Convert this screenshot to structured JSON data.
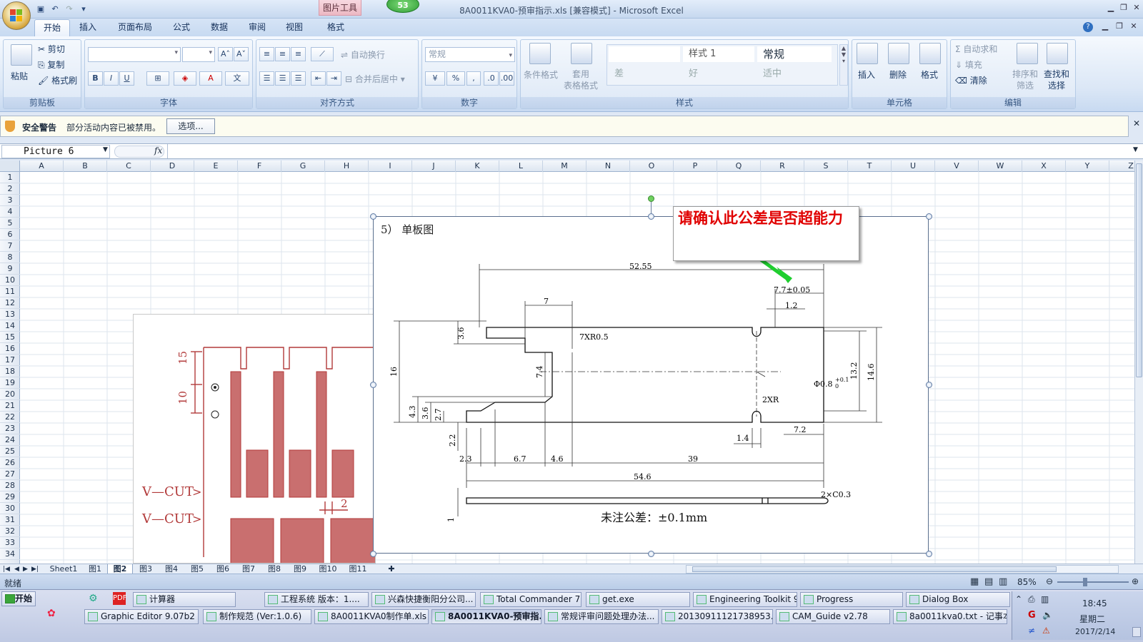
{
  "window": {
    "title": "8A0011KVA0-预审指示.xls  [兼容模式] - Microsoft Excel",
    "contextual_tab": "图片工具",
    "badge": "53"
  },
  "tabs": [
    "开始",
    "插入",
    "页面布局",
    "公式",
    "数据",
    "审阅",
    "视图",
    "格式"
  ],
  "ribbon": {
    "clipboard": {
      "label": "剪贴板",
      "paste": "粘贴",
      "cut": "剪切",
      "copy": "复制",
      "format_painter": "格式刷"
    },
    "font": {
      "label": "字体",
      "bold": "B",
      "italic": "I",
      "underline": "U",
      "grow": "A˄",
      "shrink": "A˅"
    },
    "alignment": {
      "label": "对齐方式",
      "wrap": "自动换行",
      "merge": "合并后居中"
    },
    "number": {
      "label": "数字",
      "format": "常规",
      "percent": "%",
      "comma": ","
    },
    "styles": {
      "label": "样式",
      "conditional": "条件格式",
      "table_format": "套用\n表格格式",
      "cells": [
        "样式 1",
        "常规",
        "差",
        "好",
        "适中"
      ]
    },
    "cells": {
      "label": "单元格",
      "insert": "插入",
      "delete": "删除",
      "format": "格式"
    },
    "editing": {
      "label": "编辑",
      "autosum": "自动求和",
      "fill": "填充",
      "clear": "清除",
      "sort": "排序和\n筛选",
      "find": "查找和\n选择"
    }
  },
  "security": {
    "title": "安全警告",
    "message": "部分活动内容已被禁用。",
    "options_button": "选项..."
  },
  "formula_bar": {
    "name_box": "Picture 6",
    "fx": "fx",
    "value": ""
  },
  "columns": [
    "A",
    "B",
    "C",
    "D",
    "E",
    "F",
    "G",
    "H",
    "I",
    "J",
    "K",
    "L",
    "M",
    "N",
    "O",
    "P",
    "Q",
    "R",
    "S",
    "T",
    "U",
    "V",
    "W",
    "X",
    "Y",
    "Z"
  ],
  "rows": [
    "1",
    "2",
    "3",
    "4",
    "5",
    "6",
    "7",
    "8",
    "9",
    "10",
    "11",
    "12",
    "13",
    "14",
    "15",
    "16",
    "17",
    "18",
    "19",
    "20",
    "21",
    "22",
    "23",
    "24",
    "25",
    "26",
    "27",
    "28",
    "29",
    "30",
    "31",
    "32",
    "33",
    "34"
  ],
  "drawing": {
    "heading": "5） 单板图",
    "note": "未注公差：±0.1mm",
    "dims": {
      "total_top": "52.55",
      "seg7": "7",
      "tol": "7.7±0.05",
      "d12": "1.2",
      "r7": "7XR0.5",
      "d36": "3.6",
      "d16": "16",
      "d74": "7.4",
      "d132": "13.2",
      "d146": "14.6",
      "phi": "Φ0.8",
      "phi_tol": "+0.1",
      "phi_tol2": "0",
      "r2": "2XR",
      "d43": "4.3",
      "d36b": "3.6",
      "d27": "2.7",
      "d22": "2.2",
      "d14": "1.4",
      "d72": "7.2",
      "d23": "2.3",
      "d67": "6.7",
      "d46": "4.6",
      "d39": "39",
      "d546": "54.6",
      "c03": "2×C0.3",
      "d1": "1"
    }
  },
  "left_picture": {
    "vcut1": "V—CUT",
    "vcut2": "V—CUT",
    "dim15": "15",
    "dim10": "10",
    "dim2": "2"
  },
  "callout": {
    "text": "请确认此公差是否超能力"
  },
  "sheet_tabs": [
    "Sheet1",
    "图1",
    "图2",
    "图3",
    "图4",
    "图5",
    "图6",
    "图7",
    "图8",
    "图9",
    "图10",
    "图11"
  ],
  "active_sheet": "图2",
  "status": {
    "ready": "就绪",
    "zoom": "85%"
  },
  "taskbar": {
    "start": "开始",
    "row1": [
      "计算器",
      "工程系统  版本：1....",
      "兴森快捷衡阳分公司...",
      "Total Commander 7.0 ...",
      "get.exe",
      "Engineering Toolkit 9....",
      "Progress",
      "Dialog Box"
    ],
    "row2": [
      "Graphic Editor 9.07b2 (0...",
      "制作规范 (Ver:1.0.6)",
      "8A0011KVA0制作单.xls ...",
      "8A0011KVA0-预审指...",
      "常规评审问题处理办法...",
      "20130911121738953.rtf...",
      "CAM_Guide v2.78",
      "8a0011kva0.txt - 记事本"
    ],
    "time": "18:45",
    "weekday": "星期二",
    "date": "2017/2/14"
  }
}
